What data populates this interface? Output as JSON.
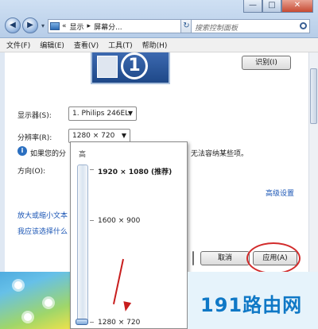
{
  "window": {
    "controls": {
      "minimize": "—",
      "maximize": "□",
      "close": "✕"
    },
    "nav": {
      "back": "◀",
      "forward": "▶",
      "dropdown": "▾"
    },
    "address": {
      "prefix": "«",
      "segment1": "显示",
      "separator": "▸",
      "segment2": "屏幕分...",
      "refresh": "↻"
    },
    "search": {
      "placeholder": "搜索控制面板"
    }
  },
  "menubar": [
    {
      "label": "文件(F)"
    },
    {
      "label": "编辑(E)"
    },
    {
      "label": "查看(V)"
    },
    {
      "label": "工具(T)"
    },
    {
      "label": "帮助(H)"
    }
  ],
  "display_settings": {
    "monitor_number": "1",
    "identify_button": "识别(I)",
    "display_label": "显示器(S):",
    "display_value": "1. Philips 246EL",
    "resolution_label": "分辨率(R):",
    "resolution_value": "1280 × 720",
    "warning_prefix": "如果您的分",
    "warning_suffix": "无法容纳某些项。",
    "orientation_label": "方向(O):",
    "advanced_link": "高级设置",
    "link1": "放大或缩小文本",
    "link2": "我应该选择什么",
    "cancel_button": "取消",
    "apply_button": "应用(A)"
  },
  "resolution_popup": {
    "high_label": "高",
    "options": [
      {
        "label": "1920 × 1080 (推荐)",
        "bold": true
      },
      {
        "label": "1600 × 900",
        "bold": false
      },
      {
        "label": "1280 × 720",
        "bold": false
      }
    ],
    "selected": "1280 × 720"
  },
  "watermark": "191路由网",
  "colors": {
    "accent": "#1a55b5",
    "annotation": "#d22b2b",
    "watermark": "#0f78c6"
  }
}
